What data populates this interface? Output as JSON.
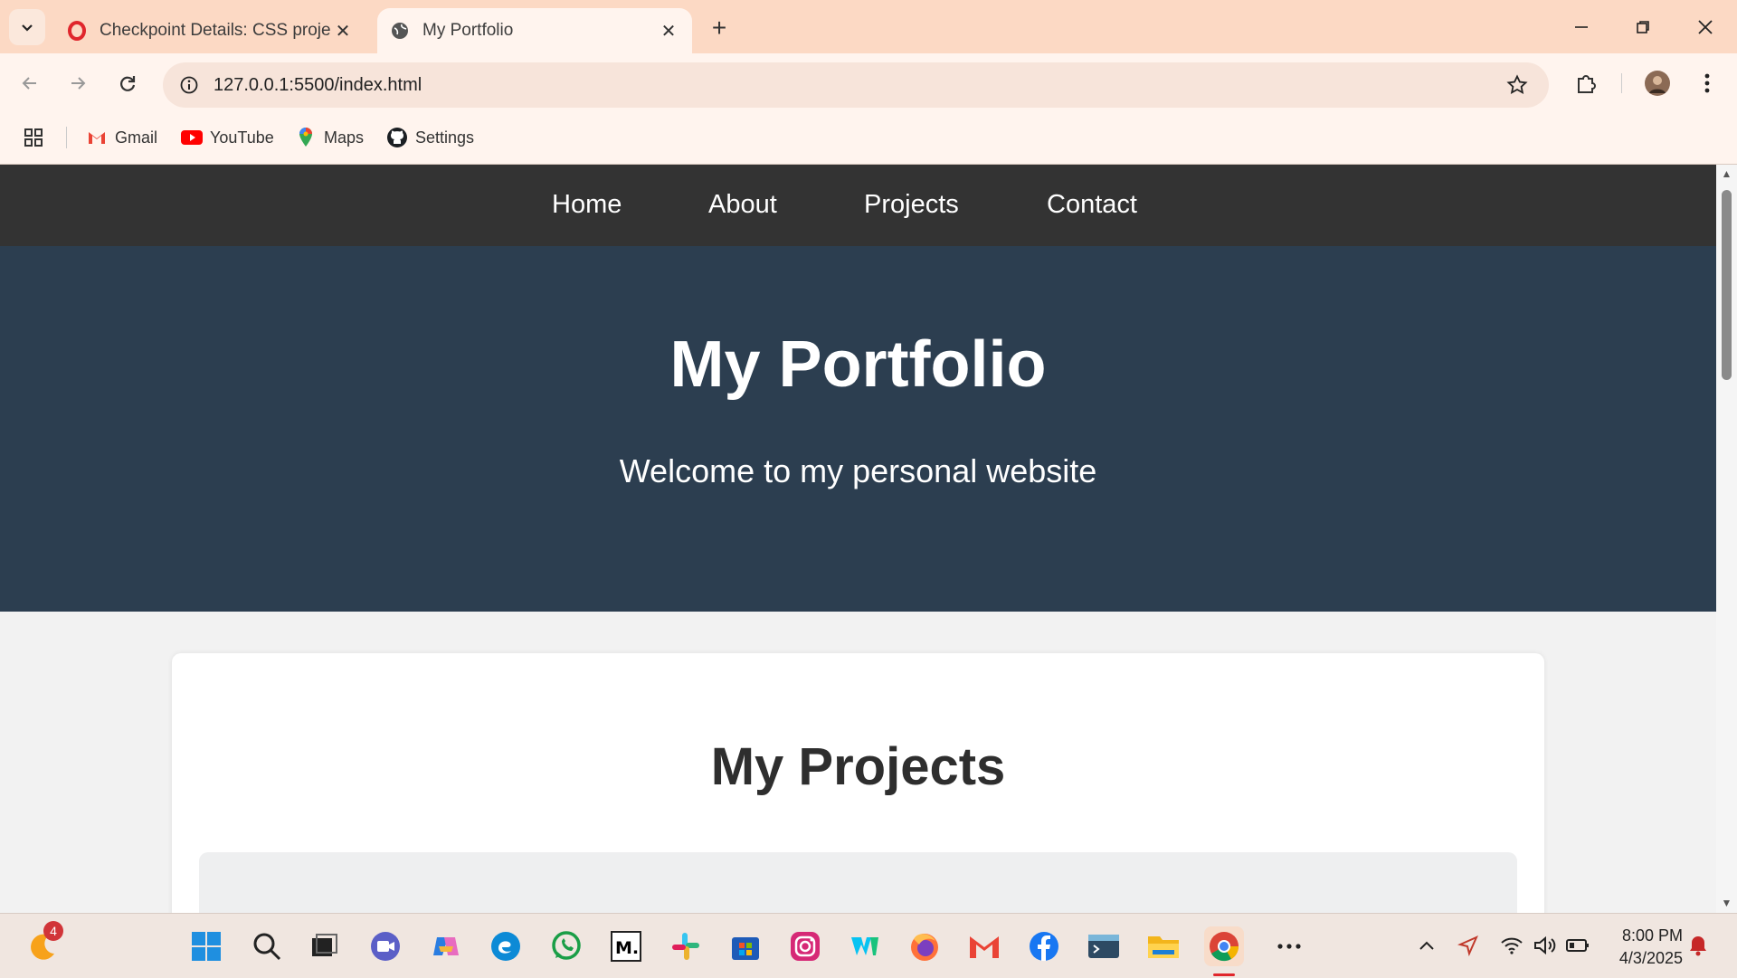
{
  "browser": {
    "tabs": [
      {
        "title": "Checkpoint Details: CSS project",
        "favicon": "opera-icon"
      },
      {
        "title": "My Portfolio",
        "favicon": "globe-icon"
      }
    ],
    "url": "127.0.0.1:5500/index.html",
    "bookmarks": [
      {
        "label": "Gmail",
        "icon": "gmail-icon"
      },
      {
        "label": "YouTube",
        "icon": "youtube-icon"
      },
      {
        "label": "Maps",
        "icon": "maps-icon"
      },
      {
        "label": "Settings",
        "icon": "github-icon"
      }
    ]
  },
  "page": {
    "nav": [
      "Home",
      "About",
      "Projects",
      "Contact"
    ],
    "hero": {
      "title": "My Portfolio",
      "subtitle": "Welcome to my personal website"
    },
    "projects_heading": "My Projects"
  },
  "taskbar": {
    "notification_badge": "4",
    "time": "8:00 PM",
    "date": "4/3/2025"
  },
  "colors": {
    "nav_bg": "#333333",
    "hero_bg": "#2c3e50",
    "page_bg": "#f2f2f2",
    "chrome_bg": "#fcd9c4"
  }
}
